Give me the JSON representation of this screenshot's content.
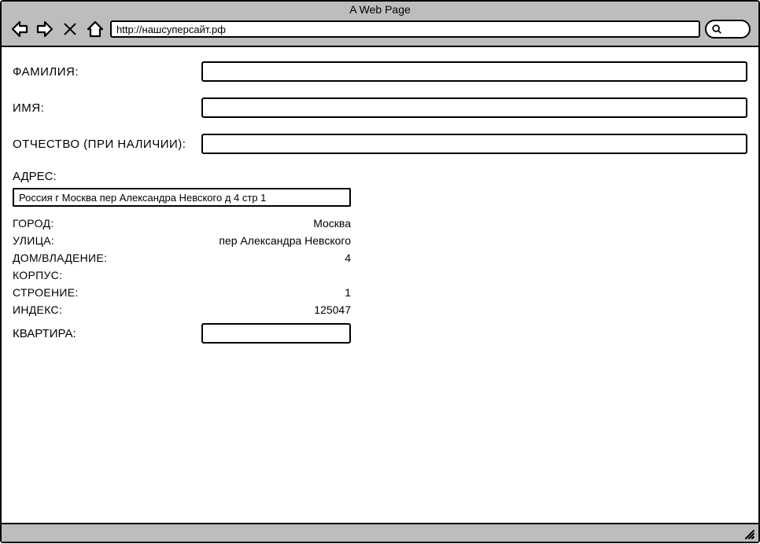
{
  "browser": {
    "title": "A Web Page",
    "url": "http://нашсуперсайт.рф"
  },
  "form": {
    "surname_label": "ФАМИЛИЯ:",
    "surname_value": "",
    "name_label": "ИМЯ:",
    "name_value": "",
    "patronymic_label": "ОТЧЕСТВО (ПРИ НАЛИЧИИ):",
    "patronymic_value": "",
    "address_section_label": "АДРЕС:",
    "address_input_value": "Россия г Москва пер Александра Невского д 4 стр 1",
    "details": {
      "city_label": "ГОРОД:",
      "city_value": "Москва",
      "street_label": "УЛИЦА:",
      "street_value": "пер Александра Невского",
      "house_label": "ДОМ/ВЛАДЕНИЕ:",
      "house_value": "4",
      "korpus_label": "КОРПУС:",
      "korpus_value": "",
      "building_label": "СТРОЕНИЕ:",
      "building_value": "1",
      "index_label": "ИНДЕКС:",
      "index_value": "125047"
    },
    "apartment_label": "КВАРТИРА:",
    "apartment_value": ""
  }
}
